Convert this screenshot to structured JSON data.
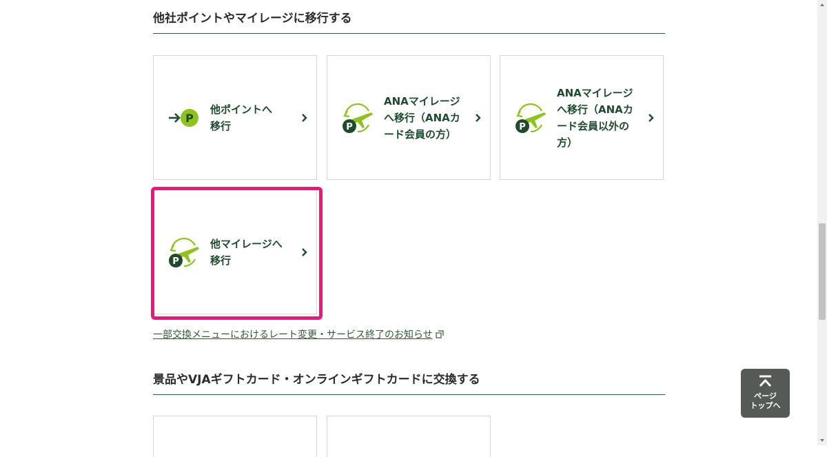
{
  "section_transfer": {
    "title": "他社ポイントやマイレージに移行する",
    "cards": [
      {
        "label_lines": [
          "他ポイントへ",
          "移行"
        ],
        "icon": "arrow-point-icon"
      },
      {
        "label_lines": [
          "ANAマイレージ",
          "へ移行（ANAカ",
          "ード会員の方）"
        ],
        "icon": "plane-point-icon"
      },
      {
        "label_lines": [
          "ANAマイレージ",
          "へ移行（ANAカ",
          "ード会員以外の",
          "方）"
        ],
        "icon": "plane-point-icon"
      },
      {
        "label_lines": [
          "他マイレージへ",
          "移行"
        ],
        "icon": "plane-point-icon",
        "highlighted": true
      }
    ]
  },
  "notice_link": {
    "text": "一部交換メニューにおけるレート変更・サービス終了のお知らせ",
    "icon": "external-link-icon"
  },
  "section_gift": {
    "title": "景品やVJAギフトカード・オンラインギフトカードに交換する"
  },
  "page_top": {
    "line1": "ページ",
    "line2": "トップへ",
    "icon": "arrow-up-to-top-icon"
  },
  "colors": {
    "brand_green": "#1e4a2e",
    "accent_lime": "#8dc21f",
    "highlight_pink": "#f0147f",
    "pagetop_bg": "#555a57"
  }
}
